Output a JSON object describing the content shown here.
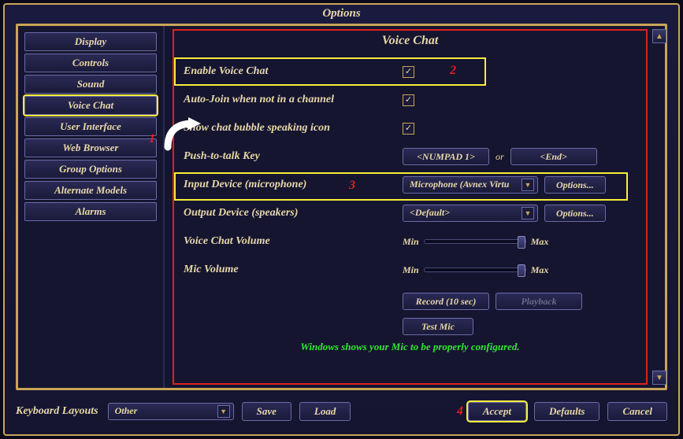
{
  "title": "Options",
  "sidebar": {
    "items": [
      {
        "label": "Display"
      },
      {
        "label": "Controls"
      },
      {
        "label": "Sound"
      },
      {
        "label": "Voice Chat",
        "selected": true
      },
      {
        "label": "User Interface"
      },
      {
        "label": "Web Browser"
      },
      {
        "label": "Group Options"
      },
      {
        "label": "Alternate Models"
      },
      {
        "label": "Alarms"
      }
    ]
  },
  "panel": {
    "title": "Voice Chat",
    "enable_label": "Enable Voice Chat",
    "enable_checked": "✓",
    "autojoin_label": "Auto-Join when not in a channel",
    "autojoin_checked": "✓",
    "bubble_label": "Show chat bubble speaking icon",
    "bubble_checked": "✓",
    "ptt_label": "Push-to-talk Key",
    "ptt_key1": "<NUMPAD 1>",
    "ptt_or": "or",
    "ptt_key2": "<End>",
    "input_label": "Input Device (microphone)",
    "input_value": "Microphone (Avnex Virtu",
    "input_options": "Options...",
    "output_label": "Output Device (speakers)",
    "output_value": "<Default>",
    "output_options": "Options...",
    "vcvol_label": "Voice Chat Volume",
    "micvol_label": "Mic Volume",
    "slider_min": "Min",
    "slider_max": "Max",
    "record_label": "Record (10 sec)",
    "playback_label": "Playback",
    "testmic_label": "Test Mic",
    "status": "Windows shows your Mic to be properly configured."
  },
  "bottom": {
    "kl_label": "Keyboard Layouts",
    "kl_value": "Other",
    "save": "Save",
    "load": "Load",
    "accept": "Accept",
    "defaults": "Defaults",
    "cancel": "Cancel"
  },
  "annotations": {
    "n1": "1",
    "n2": "2",
    "n3": "3",
    "n4": "4"
  }
}
